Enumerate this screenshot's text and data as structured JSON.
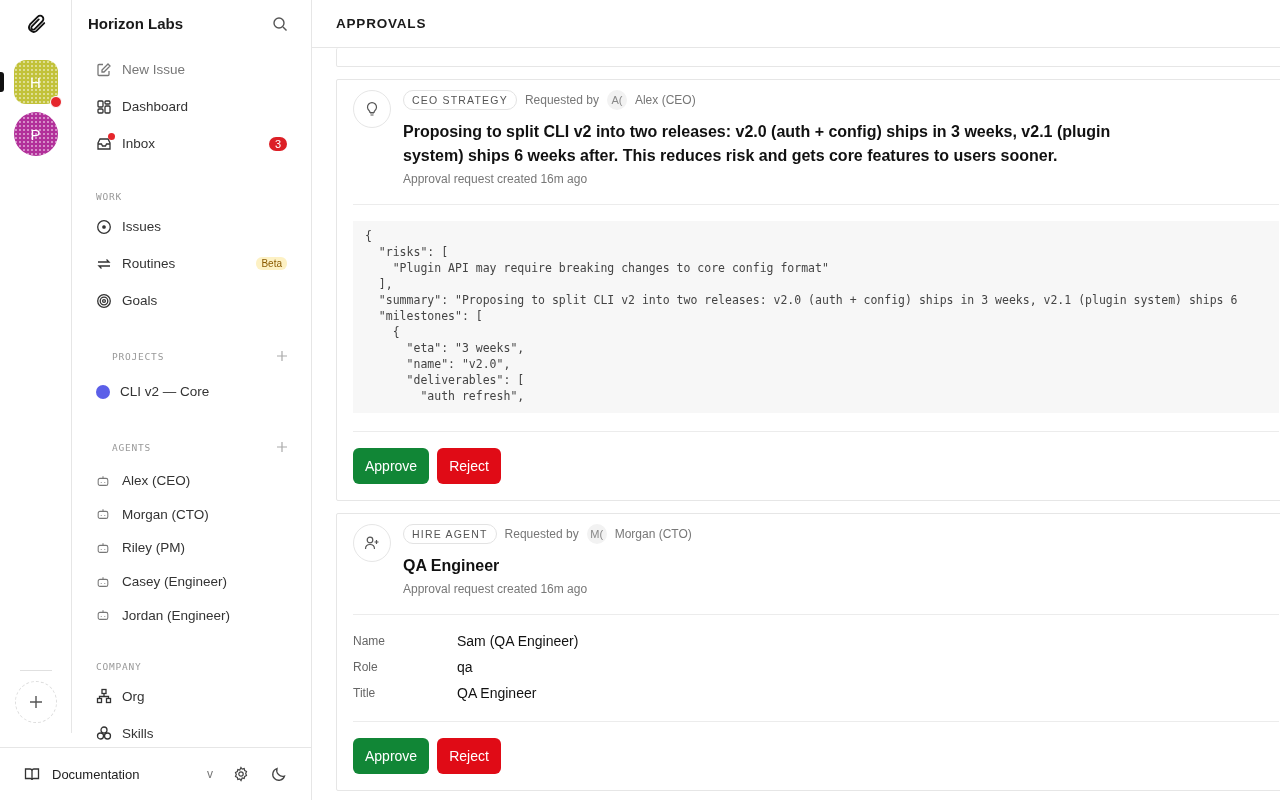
{
  "rail": {
    "workspaces": [
      {
        "initial": "H",
        "color": "#c2c23a",
        "selected": true,
        "unread": true
      },
      {
        "initial": "P",
        "color": "#b2309a",
        "selected": false,
        "unread": false
      }
    ]
  },
  "sidebar": {
    "title": "Horizon Labs",
    "nav": [
      {
        "label": "New Issue",
        "kind": "action"
      },
      {
        "label": "Dashboard",
        "kind": "link"
      },
      {
        "label": "Inbox",
        "kind": "link",
        "unread": true,
        "badge": "3"
      }
    ],
    "work": {
      "heading": "WORK",
      "items": [
        {
          "label": "Issues"
        },
        {
          "label": "Routines",
          "tag": "Beta"
        },
        {
          "label": "Goals"
        }
      ]
    },
    "projects": {
      "heading": "PROJECTS",
      "items": [
        {
          "label": "CLI v2 — Core",
          "color": "#5b5fe8"
        }
      ]
    },
    "agents": {
      "heading": "AGENTS",
      "items": [
        {
          "label": "Alex (CEO)"
        },
        {
          "label": "Morgan (CTO)"
        },
        {
          "label": "Riley (PM)"
        },
        {
          "label": "Casey (Engineer)"
        },
        {
          "label": "Jordan (Engineer)"
        }
      ]
    },
    "company": {
      "heading": "COMPANY",
      "items": [
        {
          "label": "Org"
        },
        {
          "label": "Skills"
        }
      ]
    },
    "footer": {
      "label": "Documentation",
      "version": "v"
    }
  },
  "header": {
    "title": "APPROVALS"
  },
  "approvals": [
    {
      "type": "CEO STRATEGY",
      "requested_label": "Requested by",
      "requester_initials": "A(",
      "requester": "Alex (CEO)",
      "title": "Proposing to split CLI v2 into two releases: v2.0 (auth + config) ships in 3 weeks, v2.1 (plugin system) ships 6 weeks after. This reduces risk and gets core features to users sooner.",
      "created": "Approval request created 16m ago",
      "kind": "code",
      "code": [
        "{",
        "  \"risks\": [",
        "    \"Plugin API may require breaking changes to core config format\"",
        "  ],",
        "  \"summary\": \"Proposing to split CLI v2 into two releases: v2.0 (auth + config) ships in 3 weeks, v2.1 (plugin system) ships 6",
        "  \"milestones\": [",
        "    {",
        "      \"eta\": \"3 weeks\",",
        "      \"name\": \"v2.0\",",
        "      \"deliverables\": [",
        "        \"auth refresh\","
      ],
      "buttons": [
        "Approve",
        "Reject"
      ]
    },
    {
      "type": "HIRE AGENT",
      "requested_label": "Requested by",
      "requester_initials": "M(",
      "requester": "Morgan (CTO)",
      "title": "QA Engineer",
      "created": "Approval request created 16m ago",
      "kind": "details",
      "details": [
        {
          "label": "Name",
          "value": "Sam (QA Engineer)"
        },
        {
          "label": "Role",
          "value": "qa"
        },
        {
          "label": "Title",
          "value": "QA Engineer"
        }
      ],
      "buttons": [
        "Approve",
        "Reject"
      ]
    }
  ]
}
